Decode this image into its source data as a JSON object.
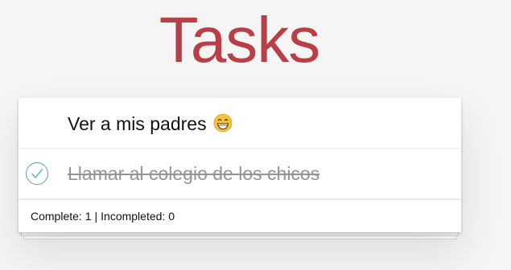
{
  "app": {
    "title": "Tasks"
  },
  "todos": [
    {
      "label": "Ver a mis padres",
      "emoji": "grinning-face-icon",
      "completed": false
    },
    {
      "label": "Llamar al colegio de los chicos",
      "completed": true
    }
  ],
  "footer": {
    "complete_label": "Complete:",
    "complete_count": "1",
    "separator": "|",
    "incompleted_label": "Incompleted:",
    "incompleted_count": "0"
  },
  "colors": {
    "title": "#b83f45",
    "check": "#5d9fad",
    "completed_text": "#949494",
    "background": "#f5f5f5"
  }
}
